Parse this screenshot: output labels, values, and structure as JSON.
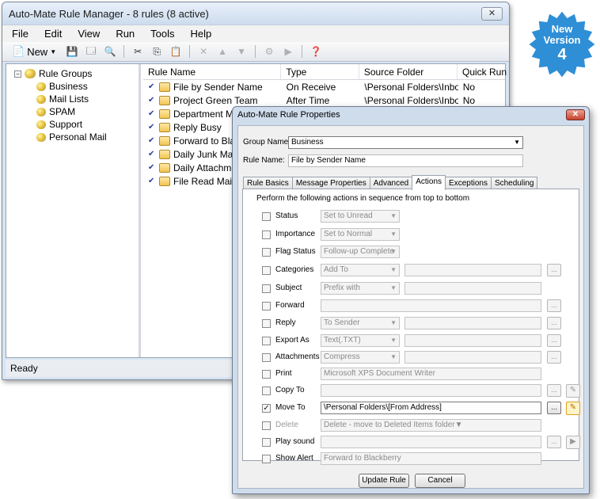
{
  "main": {
    "title": "Auto-Mate Rule Manager - 8 rules (8 active)",
    "close_glyph": "✕",
    "menu": [
      "File",
      "Edit",
      "View",
      "Run",
      "Tools",
      "Help"
    ],
    "toolbar": {
      "new_label": "New",
      "icons": [
        "new-rule-icon",
        "save-icon",
        "properties-icon",
        "find-icon",
        "cut-icon",
        "copy-icon",
        "paste-icon",
        "delete-icon",
        "move-up-icon",
        "move-down-icon",
        "settings-icon",
        "run-icon",
        "help-icon"
      ]
    },
    "tree": {
      "root": "Rule Groups",
      "groups": [
        "Business",
        "Mail Lists",
        "SPAM",
        "Support",
        "Personal Mail"
      ]
    },
    "columns": [
      "Rule Name",
      "Type",
      "Source Folder",
      "Quick Run"
    ],
    "rules": [
      {
        "name": "File by Sender Name",
        "type": "On Receive",
        "source": "\\Personal Folders\\Inbox",
        "quick": "No"
      },
      {
        "name": "Project Green Team",
        "type": "After Time",
        "source": "\\Personal Folders\\Inbox",
        "quick": "No"
      },
      {
        "name": "Department Mes",
        "type": "",
        "source": "",
        "quick": ""
      },
      {
        "name": "Reply Busy",
        "type": "",
        "source": "",
        "quick": ""
      },
      {
        "name": "Forward to Black",
        "type": "",
        "source": "",
        "quick": ""
      },
      {
        "name": "Daily Junk Mail P",
        "type": "",
        "source": "",
        "quick": ""
      },
      {
        "name": "Daily Attachment",
        "type": "",
        "source": "",
        "quick": ""
      },
      {
        "name": "File Read Main",
        "type": "",
        "source": "",
        "quick": ""
      }
    ],
    "status": "Ready"
  },
  "badge": {
    "line1": "New",
    "line2": "Version",
    "number": "4"
  },
  "dialog": {
    "title": "Auto-Mate Rule Properties",
    "close_glyph": "✕",
    "group_label": "Group Name:",
    "group_value": "Business",
    "rule_label": "Rule Name:",
    "rule_value": "File by Sender Name",
    "tabs": [
      "Rule Basics",
      "Message Properties",
      "Advanced",
      "Actions",
      "Exceptions",
      "Scheduling"
    ],
    "active_tab": "Actions",
    "instructions": "Perform the following actions in sequence from top to bottom",
    "actions": [
      {
        "label": "Status",
        "select": "Set to Unread"
      },
      {
        "label": "Importance",
        "select": "Set to Normal"
      },
      {
        "label": "Flag Status",
        "select": "Follow-up Complete"
      },
      {
        "label": "Categories",
        "select": "Add To"
      },
      {
        "label": "Subject",
        "select": "Prefix with"
      },
      {
        "label": "Forward"
      },
      {
        "label": "Reply",
        "select": "To Sender"
      },
      {
        "label": "Export As",
        "select": "Text(.TXT)"
      },
      {
        "label": "Attachments",
        "select": "Compress"
      },
      {
        "label": "Print",
        "value": "Microsoft XPS Document Writer"
      },
      {
        "label": "Copy To"
      },
      {
        "label": "Move To",
        "value": "\\Personal Folders\\[From Address]",
        "checked": "✓"
      },
      {
        "label": "Delete",
        "value": "Delete - move to Deleted Items folder"
      },
      {
        "label": "Play sound"
      },
      {
        "label": "Show Alert",
        "value": "Forward to Blackberry"
      }
    ],
    "dots_label": "...",
    "update_button": "Update Rule",
    "cancel_button": "Cancel"
  }
}
